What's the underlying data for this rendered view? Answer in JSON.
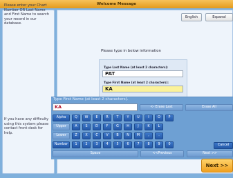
{
  "window": {
    "title": "Welcome Message"
  },
  "sidebar": {
    "top_text": "Please enter your Chart Number OR Last Name and First Name to search your record in our database.",
    "bottom_text": "If you have any difficulty using this system please contact front desk for help."
  },
  "language": {
    "english_label": "English",
    "espanol_label": "Espanol"
  },
  "form": {
    "prompt": "Please type in below information",
    "last_name_label": "Type Last Name (at least 2 characters):",
    "last_name_value": "PAT",
    "first_name_label": "Type First Name (at least 2 characters):",
    "first_name_value": "KA"
  },
  "keyboard": {
    "header": "Type First Name (at least 2 characters).",
    "input_value": "KA",
    "backspace_label": "<- Erase Last",
    "erase_all_label": "Erase All",
    "mode_keys": [
      "Alpha",
      "Upper",
      "Lower",
      "Number"
    ],
    "row1": [
      "Q",
      "W",
      "E",
      "R",
      "T",
      "Y",
      "U",
      "I",
      "O",
      "P"
    ],
    "row2": [
      "A",
      "S",
      "D",
      "F",
      "G",
      "H",
      "J",
      "K",
      "L"
    ],
    "row3": [
      "Z",
      "X",
      "C",
      "V",
      "B",
      "N",
      "M",
      ",",
      "."
    ],
    "row4": [
      "1",
      "2",
      "3",
      "4",
      "5",
      "6",
      "7",
      "8",
      "9",
      "0"
    ],
    "cancel_label": "Cancel",
    "space_label": "Space",
    "prev_label": "<<Previous",
    "next_label": "Next >>"
  },
  "footer": {
    "next_label": "Next >>"
  },
  "colors": {
    "accent": "#f0a020",
    "key_blue": "#2458a8",
    "highlight": "#fbf29a"
  }
}
